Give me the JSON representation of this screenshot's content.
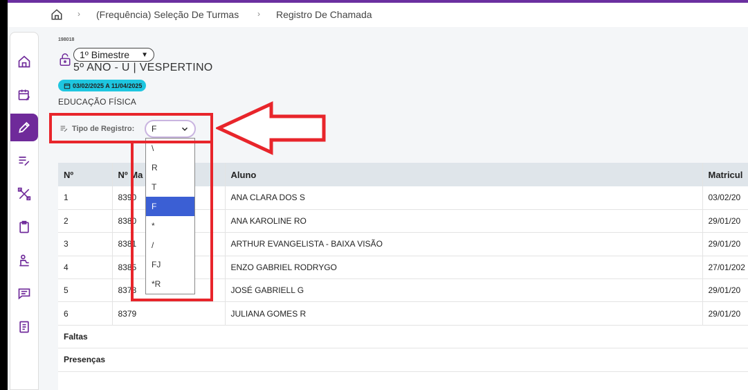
{
  "breadcrumb": {
    "items": [
      "(Frequência) Seleção De Turmas",
      "Registro De Chamada"
    ]
  },
  "sidebar": {
    "items": [
      {
        "icon": "home-icon"
      },
      {
        "icon": "calendar-edit-icon"
      },
      {
        "icon": "pencil-icon"
      },
      {
        "icon": "list-edit-icon"
      },
      {
        "icon": "tools-icon"
      },
      {
        "icon": "clipboard-icon"
      },
      {
        "icon": "student-desk-icon"
      },
      {
        "icon": "message-icon"
      },
      {
        "icon": "document-icon"
      }
    ]
  },
  "header": {
    "code": "198018",
    "period": "1º Bimestre",
    "class_name": "5º ANO - U | VESPERTINO",
    "date_range": "03/02/2025 A 11/04/2025",
    "subject": "EDUCAÇÃO FÍSICA"
  },
  "registro": {
    "label": "Tipo de Registro:",
    "selected": "F",
    "options": [
      "\\",
      "R",
      "T",
      "F",
      "*",
      "/",
      "FJ",
      "*R"
    ]
  },
  "table": {
    "columns": [
      "Nº",
      "Nº Ma",
      "Aluno",
      "Matricul"
    ],
    "rows": [
      [
        "1",
        "8390",
        "ANA CLARA DOS S",
        "03/02/20"
      ],
      [
        "2",
        "8380",
        "ANA KAROLINE RO",
        "29/01/20"
      ],
      [
        "3",
        "8381",
        "ARTHUR EVANGELISTA - BAIXA VISÃO",
        "29/01/20"
      ],
      [
        "4",
        "8385",
        "ENZO GABRIEL RODRYGO",
        "27/01/202"
      ],
      [
        "5",
        "8378",
        "JOSÉ GABRIELL G",
        "29/01/20"
      ],
      [
        "6",
        "8379",
        "JULIANA GOMES R",
        "29/01/20"
      ]
    ],
    "summary": [
      "Faltas",
      "Presenças"
    ]
  },
  "colors": {
    "accent": "#6f2a9a",
    "badge": "#1ec6e0",
    "annotation": "#e8252b",
    "selected_option": "#3b5fd4"
  }
}
